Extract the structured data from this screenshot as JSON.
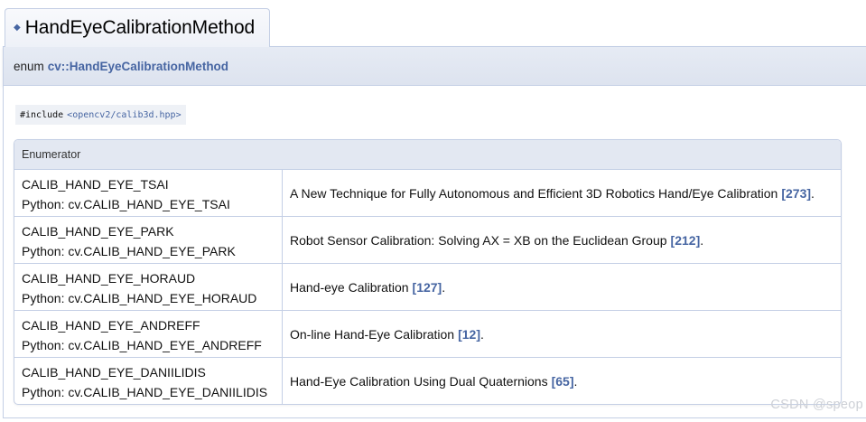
{
  "title": {
    "bullet": "◆",
    "text": "HandEyeCalibrationMethod"
  },
  "prototype": {
    "keyword": "enum",
    "name": "cv::HandEyeCalibrationMethod"
  },
  "include": {
    "directive": "#include",
    "file": "<opencv2/calib3d.hpp>"
  },
  "table": {
    "header": "Enumerator",
    "rows": [
      {
        "name": "CALIB_HAND_EYE_TSAI",
        "python": "Python: cv.CALIB_HAND_EYE_TSAI",
        "description": "A New Technique for Fully Autonomous and Efficient 3D Robotics Hand/Eye Calibration",
        "citation": "[273]",
        "suffix": "."
      },
      {
        "name": "CALIB_HAND_EYE_PARK",
        "python": "Python: cv.CALIB_HAND_EYE_PARK",
        "description": "Robot Sensor Calibration: Solving AX = XB on the Euclidean Group",
        "citation": "[212]",
        "suffix": "."
      },
      {
        "name": "CALIB_HAND_EYE_HORAUD",
        "python": "Python: cv.CALIB_HAND_EYE_HORAUD",
        "description": "Hand-eye Calibration",
        "citation": "[127]",
        "suffix": "."
      },
      {
        "name": "CALIB_HAND_EYE_ANDREFF",
        "python": "Python: cv.CALIB_HAND_EYE_ANDREFF",
        "description": "On-line Hand-Eye Calibration",
        "citation": "[12]",
        "suffix": "."
      },
      {
        "name": "CALIB_HAND_EYE_DANIILIDIS",
        "python": "Python: cv.CALIB_HAND_EYE_DANIILIDIS",
        "description": "Hand-Eye Calibration Using Dual Quaternions",
        "citation": "[65]",
        "suffix": "."
      }
    ]
  },
  "watermark": "CSDN @speop",
  "colors": {
    "link": "#4665a2",
    "border": "#c4cfe5",
    "header_bg": "#e3e8f2"
  }
}
